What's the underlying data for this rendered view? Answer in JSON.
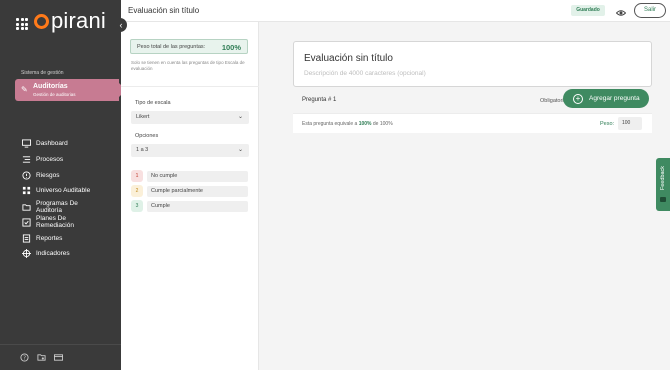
{
  "app": {
    "brand": "pirani",
    "brand_color": "#ff7a1a"
  },
  "sidebar": {
    "section_label": "Sistema de gestión",
    "active_module": {
      "title": "Auditorías",
      "subtitle": "Gestión de auditorias",
      "icon": "audit-icon",
      "color": "#c77b92"
    },
    "items": [
      {
        "label": "Dashboard",
        "icon": "monitor-icon"
      },
      {
        "label": "Procesos",
        "icon": "process-icon"
      },
      {
        "label": "Riesgos",
        "icon": "warning-circle-icon"
      },
      {
        "label": "Universo Auditable",
        "icon": "grid-icon"
      },
      {
        "label": "Programas De Auditoría",
        "icon": "folder-icon"
      },
      {
        "label": "Planes De Remediación",
        "icon": "checkbox-icon"
      },
      {
        "label": "Reportes",
        "icon": "report-icon"
      },
      {
        "label": "Indicadores",
        "icon": "target-icon"
      }
    ],
    "bottom_icons": [
      "help-icon",
      "folder-settings-icon",
      "card-icon"
    ]
  },
  "header": {
    "title": "Evaluación sin título",
    "saved_label": "Guardado",
    "exit_label": "Salir"
  },
  "settings": {
    "weight_label": "Peso total de las preguntas:",
    "weight_value": "100%",
    "weight_note": "Solo se tienen en cuenta las preguntas de tipo Escala de evaluación",
    "scale_type_label": "Tipo de escala",
    "scale_type_value": "Likert",
    "options_label": "Opciones",
    "options_value": "1 a 3",
    "options": [
      {
        "num": "1",
        "text": "No cumple",
        "bg": "#f8e0e0",
        "color": "#c0392b"
      },
      {
        "num": "2",
        "text": "Cumple parcialmente",
        "bg": "#fbf0d9",
        "color": "#c08a1e"
      },
      {
        "num": "3",
        "text": "Cumple",
        "bg": "#dff1e7",
        "color": "#2f7d55"
      }
    ]
  },
  "main": {
    "eval_title": "Evaluación sin título",
    "eval_desc_placeholder": "Descripción de 4000 caracteres (opcional)",
    "question_label": "Pregunta # 1",
    "required_label": "Obligatoria",
    "add_question_label": "Agregar pregunta",
    "equiv_prefix": "Esta pregunta equivale a",
    "equiv_pct": "100%",
    "equiv_suffix": "de 100%",
    "peso_label": "Peso:",
    "peso_value": "100"
  },
  "feedback_label": "Feedback",
  "colors": {
    "sidebar_bg": "#3a3a3a",
    "accent_green": "#3f8a61"
  }
}
